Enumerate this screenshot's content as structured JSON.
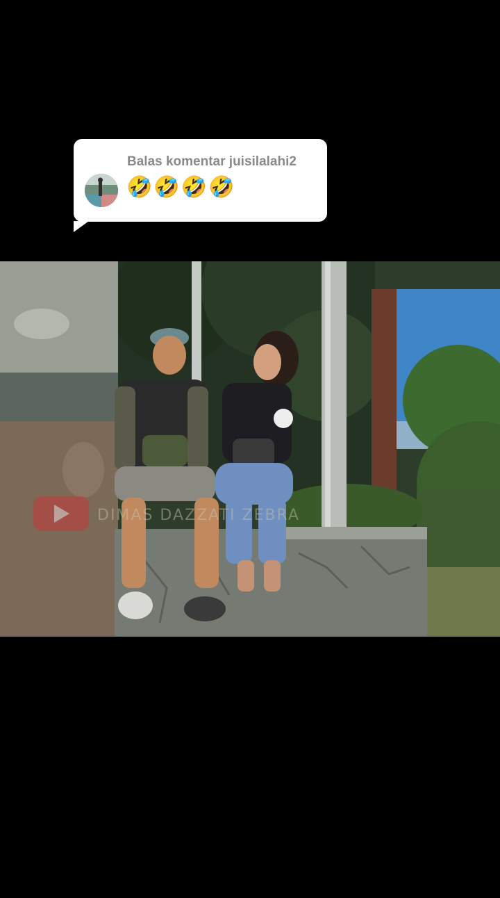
{
  "reply": {
    "title": "Balas komentar juisilalahi2",
    "text": "🤣🤣🤣🤣"
  },
  "video": {
    "watermark_text": "DIMAS DAZZATI ZEBRA"
  },
  "colors": {
    "background": "#000000",
    "bubble": "#ffffff",
    "reply_title": "#8a8a8a"
  }
}
